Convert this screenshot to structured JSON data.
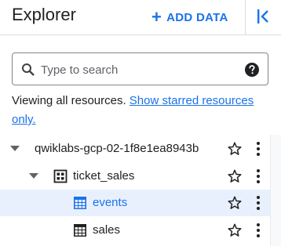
{
  "header": {
    "title": "Explorer",
    "add_data_label": "ADD DATA",
    "add_icon": "plus-icon",
    "collapse_icon": "collapse-panel-icon"
  },
  "search": {
    "placeholder": "Type to search",
    "value": "",
    "search_icon": "search-icon",
    "help_icon": "help-icon"
  },
  "info": {
    "text": "Viewing all resources. ",
    "link": "Show starred resources only."
  },
  "tree": {
    "project": {
      "label": "qwiklabs-gcp-02-1f8e1ea8943b",
      "expanded": true
    },
    "dataset": {
      "label": "ticket_sales",
      "expanded": true,
      "icon": "dataset-icon"
    },
    "tables": [
      {
        "label": "events",
        "selected": true,
        "icon": "table-icon"
      },
      {
        "label": "sales",
        "selected": false,
        "icon": "table-icon"
      }
    ]
  },
  "colors": {
    "accent": "#1a73e8",
    "selected_bg": "#e8f0fe",
    "text": "#202124",
    "icon": "#5f6368"
  }
}
